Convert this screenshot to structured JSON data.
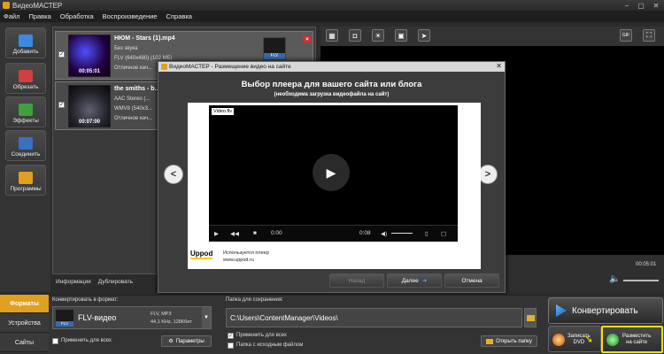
{
  "app": {
    "title": "ВидеоМАСТЕР",
    "accent": "#e0a020",
    "highlight": "#ffdd00"
  },
  "window_controls": {
    "minimize": "−",
    "maximize": "▢",
    "close": "✕"
  },
  "menu": [
    "Файл",
    "Правка",
    "Обработка",
    "Воспроизведение",
    "Справка"
  ],
  "leftbar": [
    {
      "label": "Добавить",
      "icon": "add-film-icon",
      "color": "#3a8ae0"
    },
    {
      "label": "Обрезать",
      "icon": "cut-film-icon",
      "color": "#d04040"
    },
    {
      "label": "Эффекты",
      "icon": "effects-icon",
      "color": "#40a040"
    },
    {
      "label": "Соединить",
      "icon": "join-icon",
      "color": "#3a70c0"
    },
    {
      "label": "Программы",
      "icon": "programs-icon",
      "color": "#e0a020"
    }
  ],
  "files": [
    {
      "name": "НЮМ - Stars (1).mp4",
      "time": "00:05:01",
      "audio": "Без звука",
      "video": "FLV (640x480) (102 МБ)",
      "quality": "Отличное кач...",
      "checked": "✓",
      "format_badge": "FLV"
    },
    {
      "name": "the smiths - b...",
      "time": "00:07:00",
      "audio": "AAC Stereo (...",
      "video": "WMV8 (540x3...",
      "quality": "Отличное кач...",
      "checked": "✓"
    }
  ],
  "file_actions": {
    "info": "Информация",
    "duplicate": "Дублировать"
  },
  "preview": {
    "time": "00:05:01",
    "gif_label": "GIF"
  },
  "dialog": {
    "title": "ВидеоМАСТЕР - Размещение видео на сайте",
    "heading": "Выбор плеера для вашего сайта или блога",
    "subheading": "(необходима загрузка видеофайла на сайт)",
    "video_logo": "Video.flv",
    "time_start": "0:00",
    "time_end": "0:08",
    "brand": "Uppod",
    "brand_note": "Используется плеер",
    "brand_url": "www.uppod.ru",
    "back": "Назад",
    "next": "Далее",
    "cancel": "Отмена",
    "prev_arrow": "<",
    "next_arrow": ">"
  },
  "tabs": [
    "Форматы",
    "Устройства",
    "Сайты"
  ],
  "format": {
    "label": "Конвертировать в формат:",
    "name": "FLV-видео",
    "badge": "FLV",
    "info1": "FLV, MP3",
    "info2": "44,1 KHz, 128Кбит",
    "apply_all": "Применить для всех",
    "params": "Параметры"
  },
  "save": {
    "label": "Папка для сохранения:",
    "path": "C:\\Users\\ContentManager\\Videos\\",
    "apply_all": "Применить для всех",
    "same_folder": "Папка с исходным файлом",
    "open_folder": "Открыть папку",
    "apply_checked": "✓"
  },
  "actions": {
    "convert": "Конвертировать",
    "dvd_line1": "Записать",
    "dvd_line2": "DVD",
    "web_line1": "Разместить",
    "web_line2": "на сайте"
  }
}
